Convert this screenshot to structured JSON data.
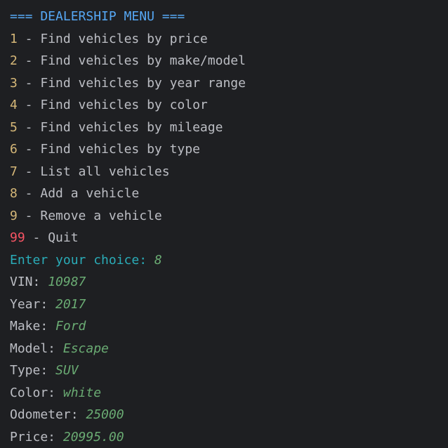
{
  "colors": {
    "background": "#1e1f22",
    "text": "#bcbec4",
    "header": "#56a8f5",
    "menu_number": "#d5b778",
    "quit_number": "#f75464",
    "prompt": "#2aacb8",
    "user_input": "#6aab73"
  },
  "header": "=== DEALERSHIP MENU ===",
  "menu": [
    {
      "num": "1",
      "sep": " - ",
      "label": "Find vehicles by price"
    },
    {
      "num": "2",
      "sep": " - ",
      "label": "Find vehicles by make/model"
    },
    {
      "num": "3",
      "sep": " - ",
      "label": "Find vehicles by year range"
    },
    {
      "num": "4",
      "sep": " - ",
      "label": "Find vehicles by color"
    },
    {
      "num": "5",
      "sep": " - ",
      "label": "Find vehicles by mileage"
    },
    {
      "num": "6",
      "sep": " - ",
      "label": "Find vehicles by type"
    },
    {
      "num": "7",
      "sep": " - ",
      "label": "List all vehicles"
    },
    {
      "num": "8",
      "sep": " - ",
      "label": "Add a vehicle"
    },
    {
      "num": "9",
      "sep": " - ",
      "label": "Remove a vehicle"
    },
    {
      "num": "99",
      "sep": " - ",
      "label": "Quit"
    }
  ],
  "prompt": {
    "label": "Enter your choice: ",
    "value": "8"
  },
  "fields": [
    {
      "label": "VIN: ",
      "value": "10987"
    },
    {
      "label": "Year: ",
      "value": "2017"
    },
    {
      "label": "Make: ",
      "value": "Ford"
    },
    {
      "label": "Model: ",
      "value": "Escape"
    },
    {
      "label": "Type: ",
      "value": "SUV"
    },
    {
      "label": "Color: ",
      "value": "white"
    },
    {
      "label": "Odometer: ",
      "value": "25000"
    },
    {
      "label": "Price: ",
      "value": "20995.00"
    }
  ]
}
